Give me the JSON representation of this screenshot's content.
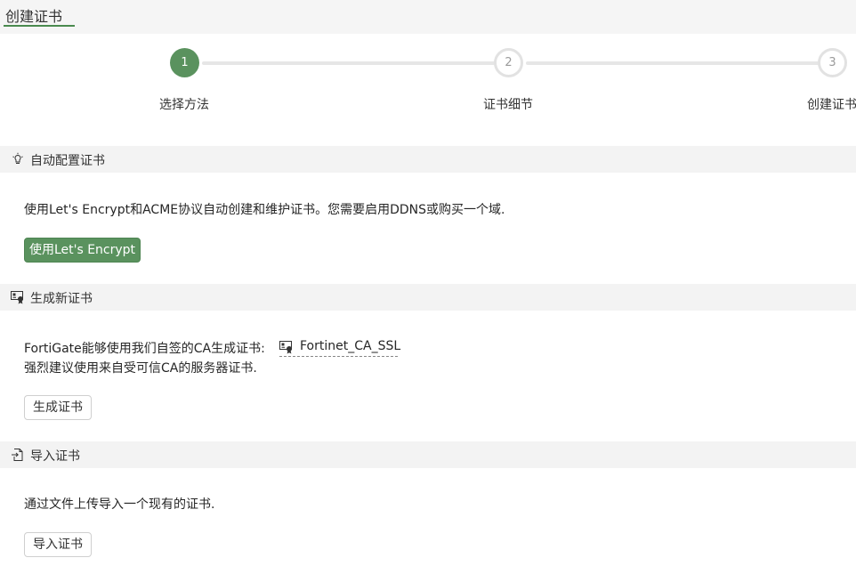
{
  "page": {
    "title": "创建证书"
  },
  "stepper": {
    "steps": [
      {
        "number": "1",
        "label": "选择方法"
      },
      {
        "number": "2",
        "label": "证书细节"
      },
      {
        "number": "3",
        "label": "创建证书"
      }
    ],
    "active_color": "#5a925e"
  },
  "sections": {
    "auto": {
      "title": "自动配置证书",
      "icon": "bulb-icon",
      "description": "使用Let's Encrypt和ACME协议自动创建和维护证书。您需要启用DDNS或购买一个域.",
      "button_label": "使用Let's Encrypt"
    },
    "generate": {
      "title": "生成新证书",
      "icon": "certificate-icon",
      "description_prefix": "FortiGate能够使用我们自签的CA生成证书:",
      "ca_name": "Fortinet_CA_SSL",
      "ca_icon": "certificate-icon",
      "description_line2": "强烈建议使用来自受可信CA的服务器证书.",
      "button_label": "生成证书"
    },
    "import": {
      "title": "导入证书",
      "icon": "import-icon",
      "description": "通过文件上传导入一个现有的证书.",
      "button_label": "导入证书"
    }
  },
  "colors": {
    "primary": "#5a925e",
    "header_bg": "#f3f3f3"
  }
}
